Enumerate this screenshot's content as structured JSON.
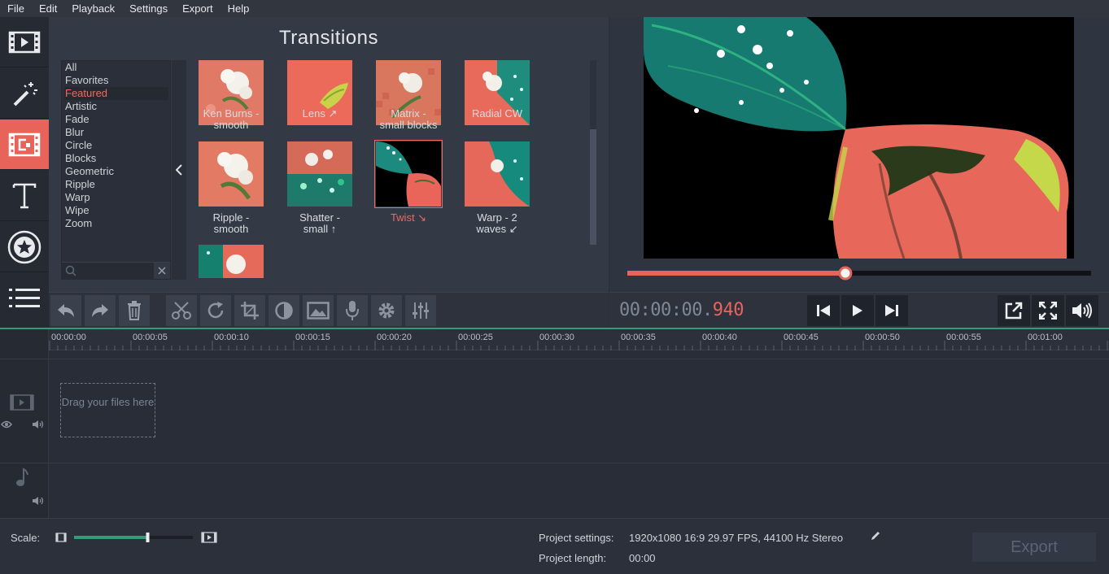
{
  "menu": [
    "File",
    "Edit",
    "Playback",
    "Settings",
    "Export",
    "Help"
  ],
  "sidebar": {
    "items": [
      {
        "name": "media-icon"
      },
      {
        "name": "magic-wand-icon"
      },
      {
        "name": "transitions-icon",
        "active": true
      },
      {
        "name": "titles-icon"
      },
      {
        "name": "stickers-icon"
      },
      {
        "name": "more-list-icon"
      }
    ]
  },
  "transitions": {
    "title": "Transitions",
    "categories": [
      "All",
      "Favorites",
      "Featured",
      "Artistic",
      "Fade",
      "Blur",
      "Circle",
      "Blocks",
      "Geometric",
      "Ripple",
      "Warp",
      "Wipe",
      "Zoom"
    ],
    "selected_category": "Featured",
    "items": [
      {
        "label1": "Ken Burns -",
        "label2": "smooth"
      },
      {
        "label1": "Lens ↗",
        "label2": ""
      },
      {
        "label1": "Matrix -",
        "label2": "small blocks"
      },
      {
        "label1": "Radial CW",
        "label2": ""
      },
      {
        "label1": "Ripple -",
        "label2": "smooth"
      },
      {
        "label1": "Shatter -",
        "label2": "small ↑"
      },
      {
        "label1": "Twist ↘",
        "label2": "",
        "selected": true
      },
      {
        "label1": "Warp - 2",
        "label2": "waves ↙"
      }
    ]
  },
  "player": {
    "timecode_main": "00:00:00.",
    "timecode_ms": "940",
    "progress": 0.47
  },
  "timeline": {
    "ruler": [
      "00:00:00",
      "00:00:05",
      "00:00:10",
      "00:00:15",
      "00:00:20",
      "00:00:25",
      "00:00:30",
      "00:00:35",
      "00:00:40",
      "00:00:45",
      "00:00:50",
      "00:00:55",
      "00:01:00"
    ],
    "dropzone_text": "Drag your files here"
  },
  "status": {
    "scale_label": "Scale:",
    "scale_value": 0.62,
    "project_settings_label": "Project settings:",
    "project_settings_value": "1920x1080 16:9 29.97 FPS, 44100 Hz Stereo",
    "project_length_label": "Project length:",
    "project_length_value": "00:00",
    "export_label": "Export"
  },
  "colors": {
    "accent": "#e8645a",
    "timeline_line": "#2f9e78"
  }
}
